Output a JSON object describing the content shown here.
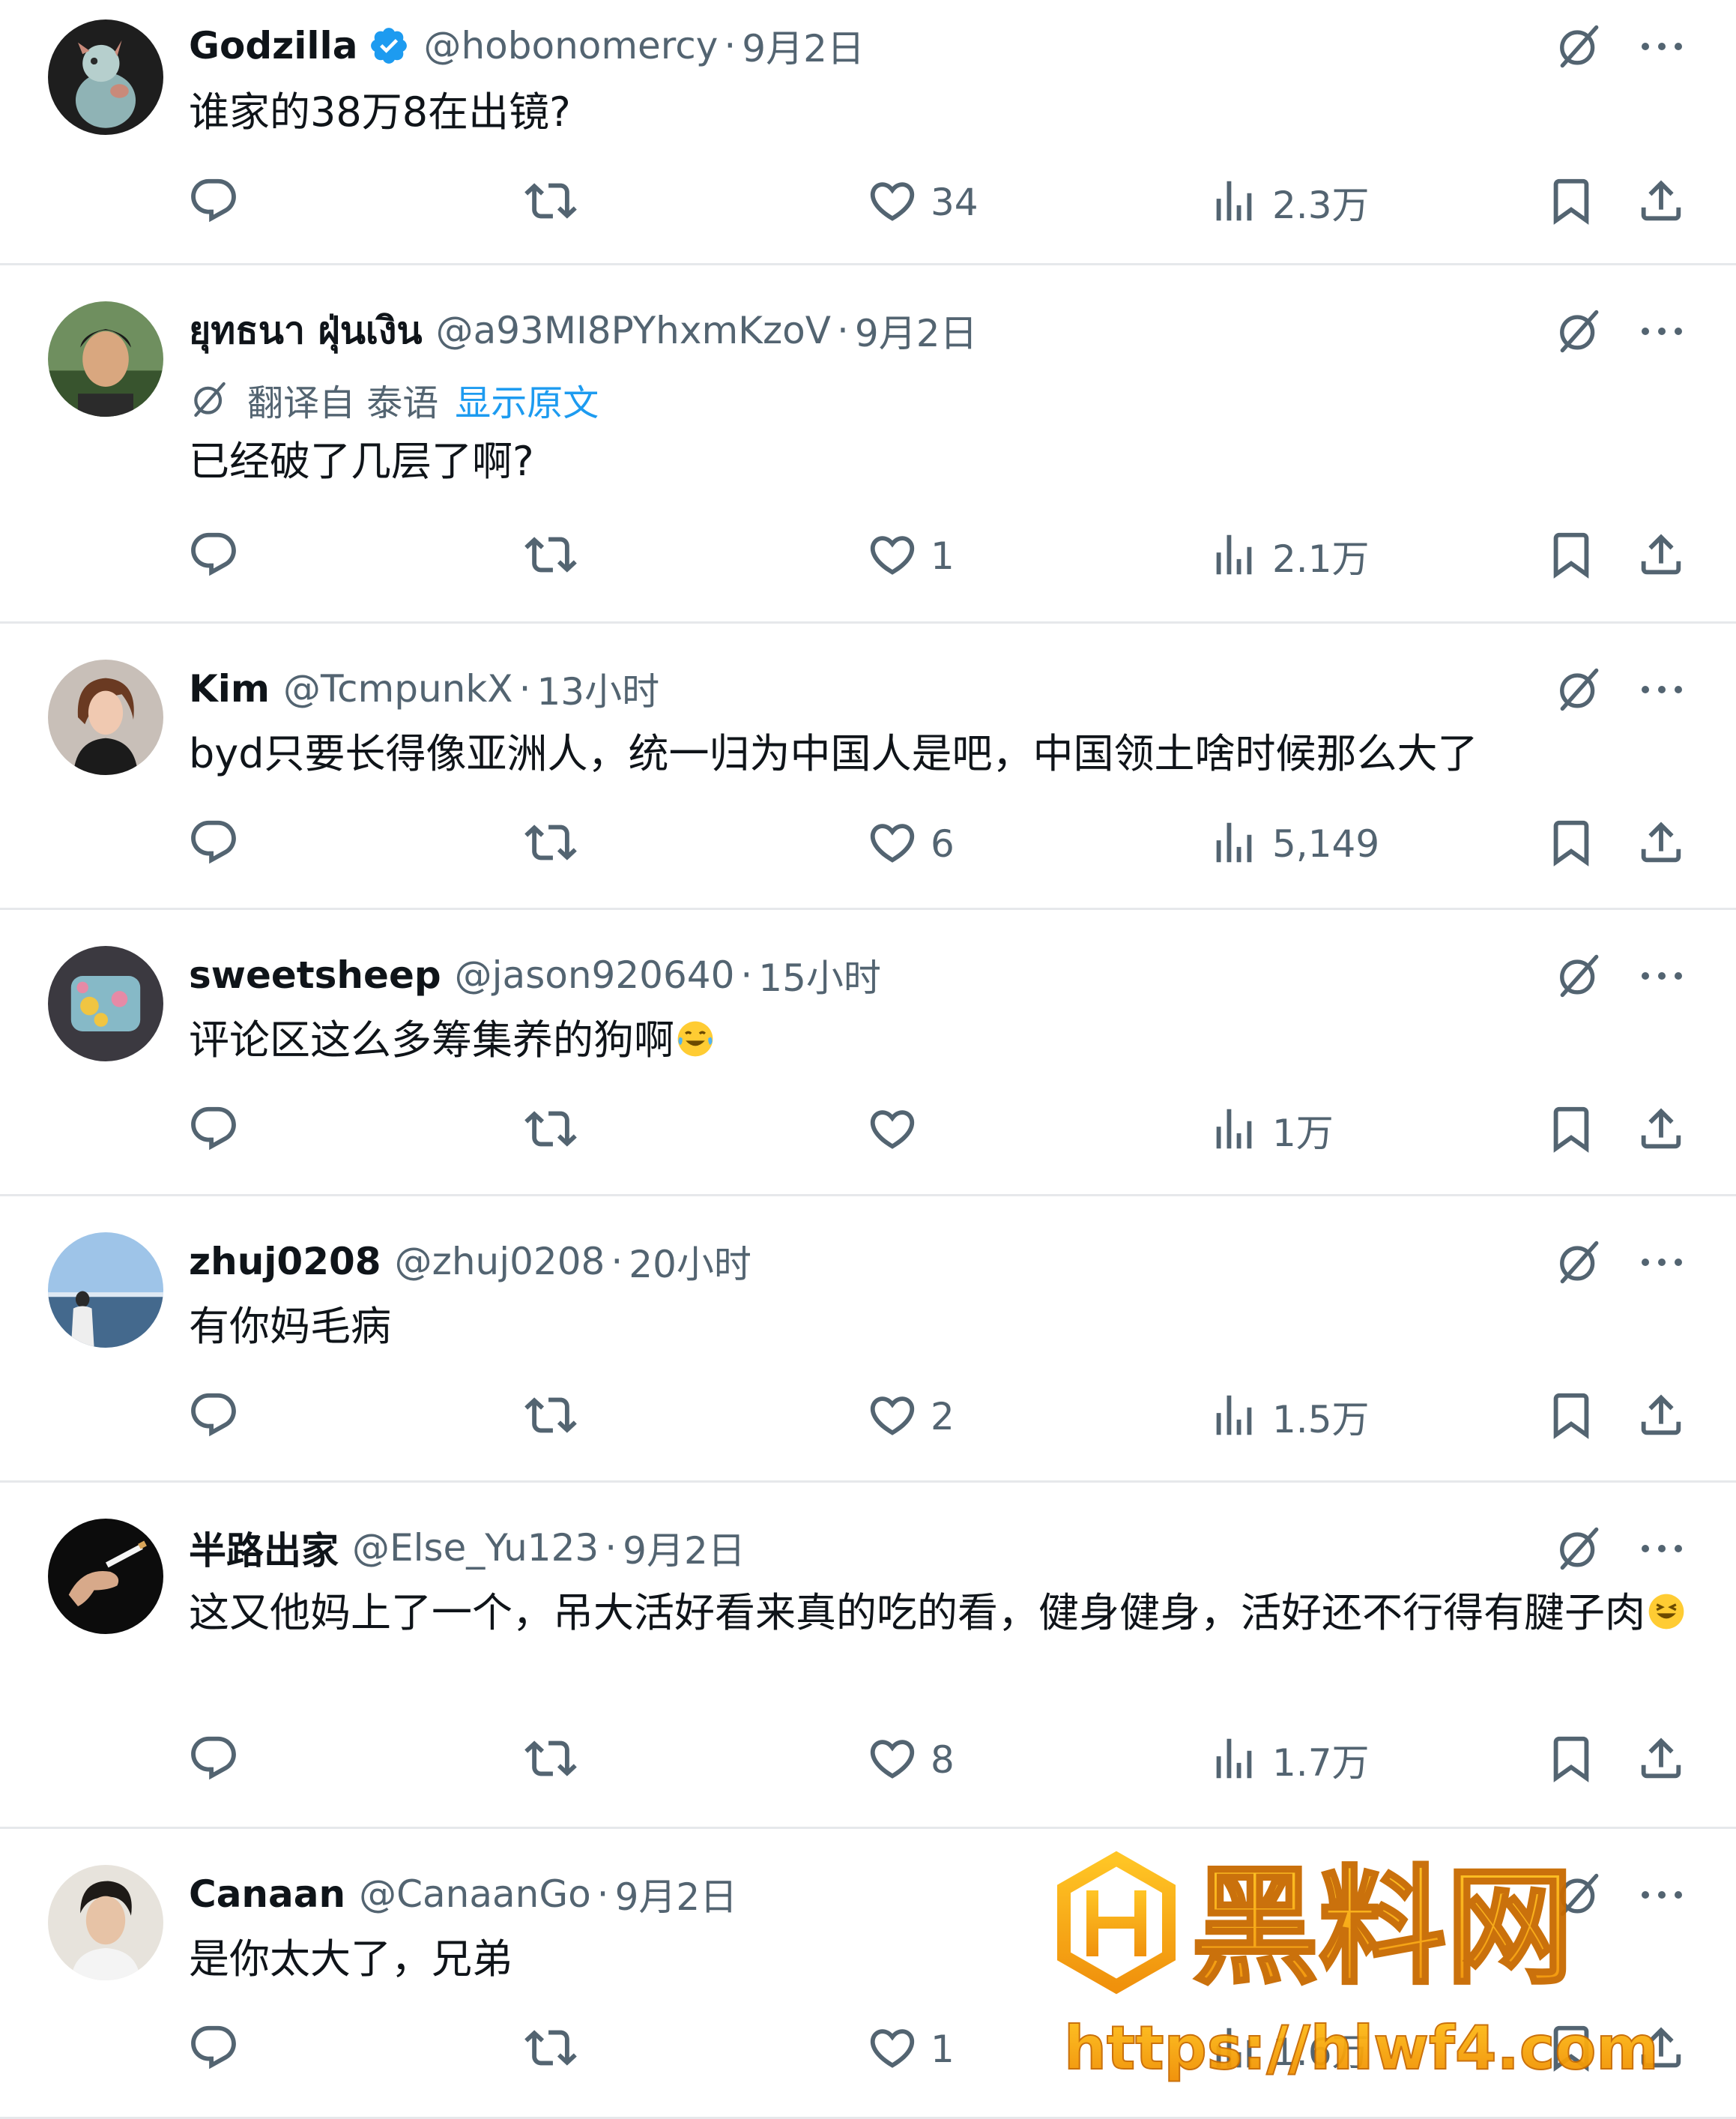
{
  "replies": [
    {
      "name": "Godzilla",
      "verified": true,
      "handle": "@hobonomercy",
      "time": "9月2日",
      "text": "谁家的38万8在出镜?",
      "emoji": "",
      "likes": "34",
      "views": "2.3万",
      "avatar": "godzilla-figure-avatar"
    },
    {
      "name": "ยุทธนา ฝุ่นเงิน",
      "verified": false,
      "handle": "@a93MI8PYhxmKzoV",
      "time": "9月2日",
      "translation": {
        "label": "翻译自 泰语",
        "link": "显示原文"
      },
      "text": "已经破了几层了啊?",
      "emoji": "",
      "likes": "1",
      "views": "2.1万",
      "avatar": "man-portrait-avatar"
    },
    {
      "name": "Kim",
      "verified": false,
      "handle": "@TcmpunkX",
      "time": "13小时",
      "text": "byd只要长得像亚洲人，统一归为中国人是吧，中国领土啥时候那么大了",
      "emoji": "",
      "likes": "6",
      "views": "5,149",
      "avatar": "woman-portrait-avatar"
    },
    {
      "name": "sweetsheep",
      "verified": false,
      "handle": "@jason920640",
      "time": "15小时",
      "text": "评论区这么多筹集养的狗啊",
      "emoji": "tears-of-joy",
      "likes": "",
      "views": "1万",
      "avatar": "toy-figure-avatar"
    },
    {
      "name": "zhuj0208",
      "verified": false,
      "handle": "@zhuj0208",
      "time": "20小时",
      "text": "有你妈毛病",
      "emoji": "",
      "likes": "2",
      "views": "1.5万",
      "avatar": "seaside-avatar"
    },
    {
      "name": "半路出家",
      "verified": false,
      "handle": "@Else_Yu123",
      "time": "9月2日",
      "text": "这又他妈上了一个，吊大活好看来真的吃的看，健身健身，活好还不行得有腱子肉",
      "emoji": "grinning-squint",
      "likes": "8",
      "views": "1.7万",
      "avatar": "hand-cigarette-avatar"
    },
    {
      "name": "Canaan",
      "verified": false,
      "handle": "@CanaanGo",
      "time": "9月2日",
      "text": "是你太大了，兄弟",
      "emoji": "",
      "likes": "1",
      "views": "1.6万",
      "avatar": "young-man-avatar"
    }
  ],
  "watermark": {
    "title": "黑料网",
    "url": "https://hlwf4.com"
  },
  "colors": {
    "text": "#0f1419",
    "secondary": "#536471",
    "link": "#1d9bf0",
    "divider": "#e6e8eb",
    "verified": "#1d9bf0",
    "watermark": "#f5a300"
  }
}
